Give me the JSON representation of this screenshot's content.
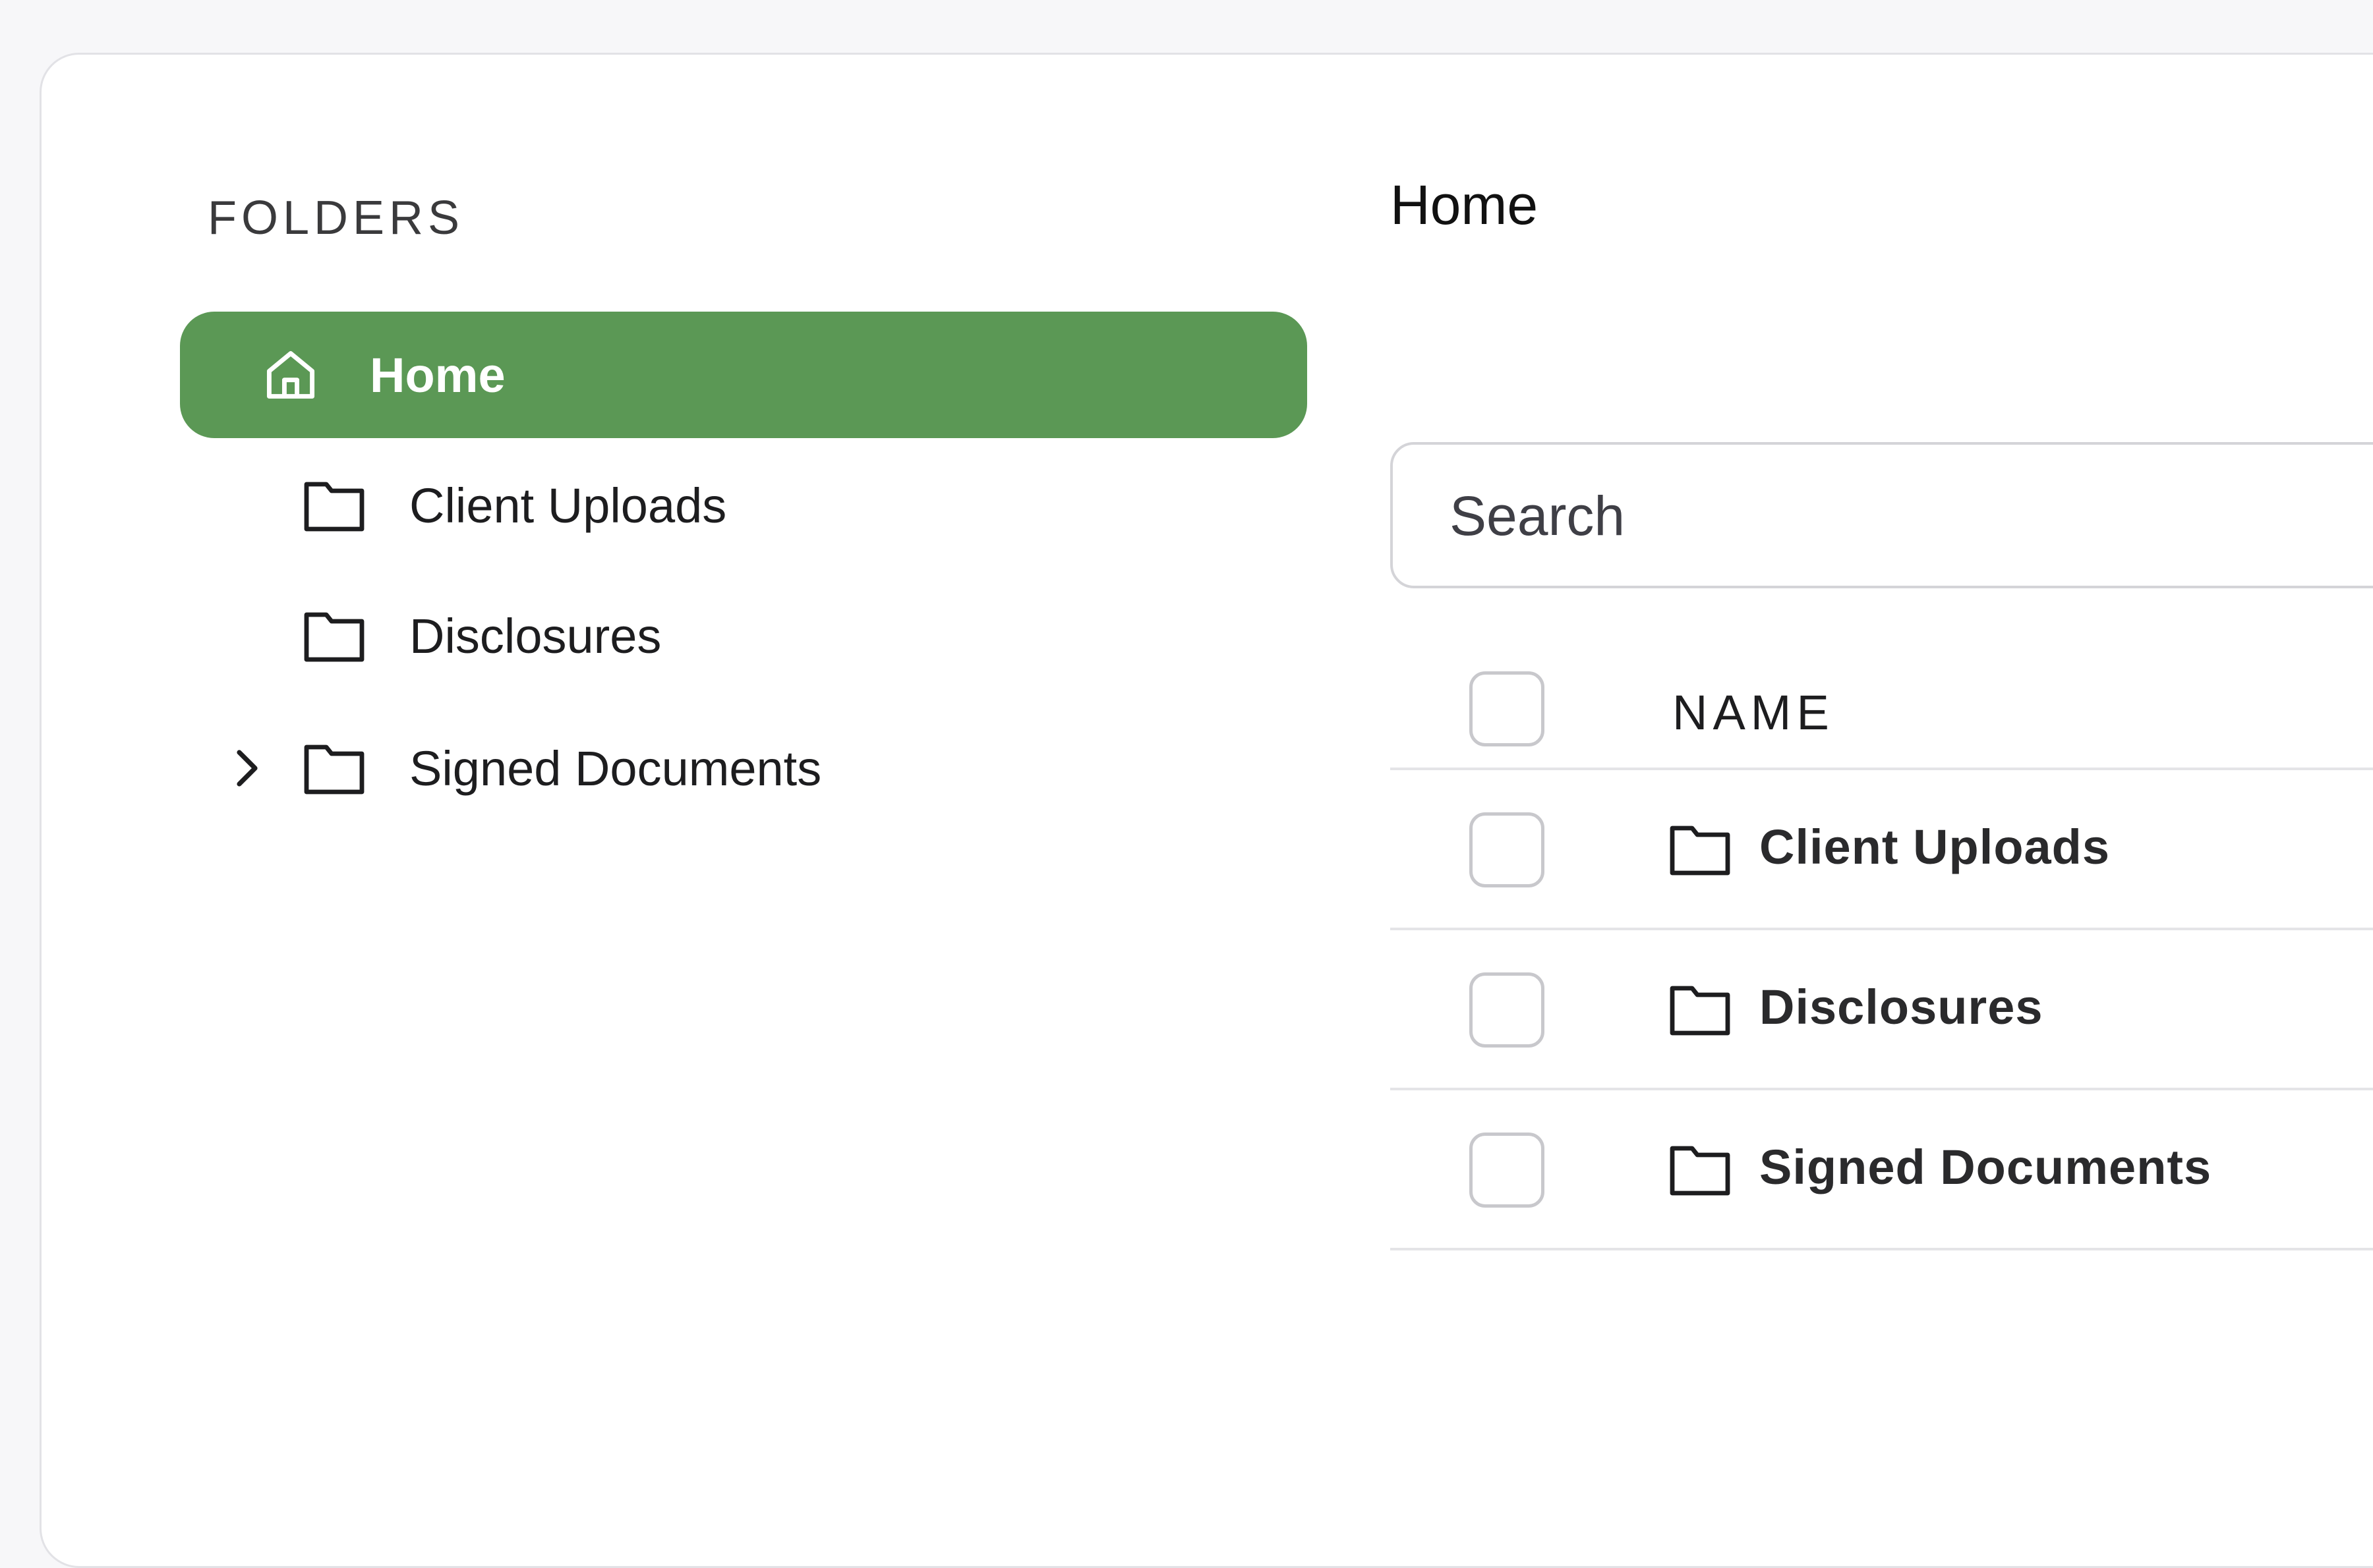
{
  "sidebar": {
    "heading": "FOLDERS",
    "items": [
      {
        "label": "Home",
        "icon": "home-icon",
        "active": true
      },
      {
        "label": "Client Uploads",
        "icon": "folder-icon"
      },
      {
        "label": "Disclosures",
        "icon": "folder-icon"
      },
      {
        "label": "Signed Documents",
        "icon": "folder-icon",
        "expandable": true
      }
    ]
  },
  "main": {
    "title": "Home",
    "search": {
      "placeholder": "Search",
      "value": ""
    },
    "table": {
      "columns": [
        "NAME"
      ],
      "rows": [
        {
          "name": "Client Uploads",
          "icon": "folder-icon"
        },
        {
          "name": "Disclosures",
          "icon": "folder-icon"
        },
        {
          "name": "Signed Documents",
          "icon": "folder-icon"
        }
      ]
    }
  },
  "colors": {
    "accent": "#5b9855",
    "background": "#f7f7f9",
    "card": "#ffffff",
    "border": "#e2e2e6"
  }
}
